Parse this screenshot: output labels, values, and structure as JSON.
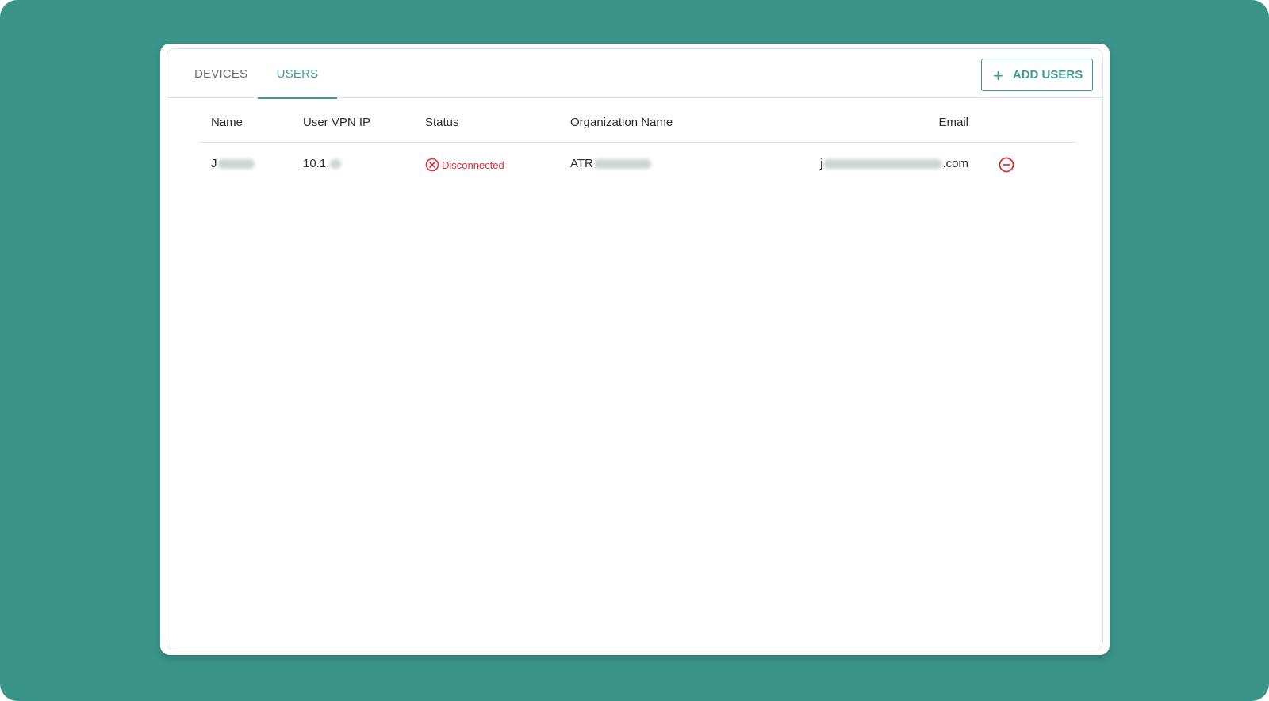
{
  "colors": {
    "background": "#3a9489",
    "accent": "#3d9c90",
    "error": "#e0303a"
  },
  "tabs": [
    {
      "label": "DEVICES",
      "active": false
    },
    {
      "label": "USERS",
      "active": true
    }
  ],
  "add_button": {
    "label": "ADD USERS",
    "icon": "plus-icon"
  },
  "table": {
    "columns": [
      "Name",
      "User VPN IP",
      "Status",
      "Organization Name",
      "Email"
    ],
    "rows": [
      {
        "name": "J",
        "user_vpn_ip": "10.1.",
        "status": "Disconnected",
        "status_icon": "circle-x-icon",
        "organization_name": "ATR",
        "email_prefix": "j",
        "email_suffix": ".com",
        "action_icon": "remove-circle-icon"
      }
    ]
  }
}
